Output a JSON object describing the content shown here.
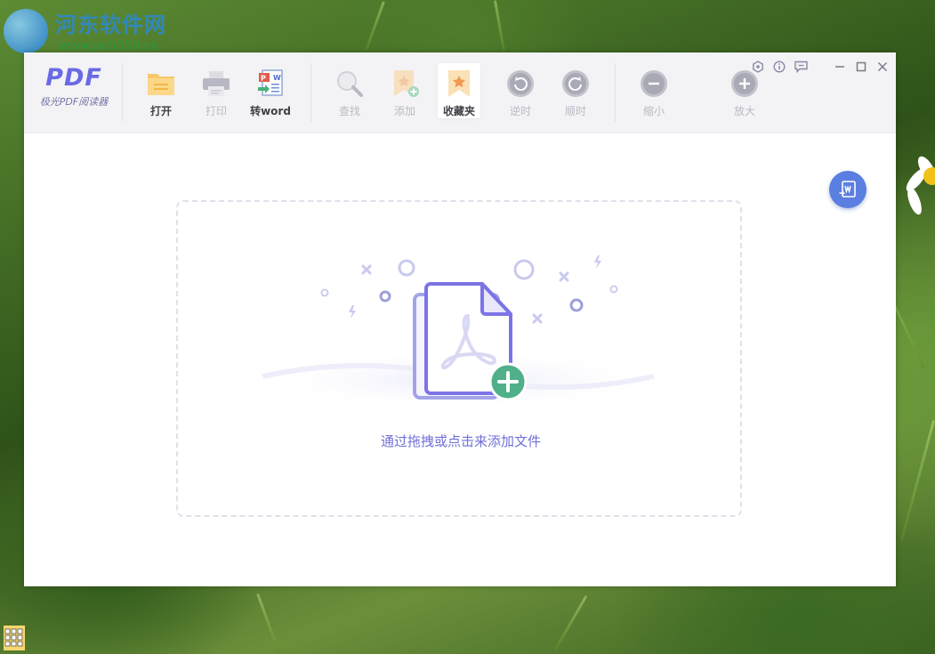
{
  "watermark": {
    "title": "河东软件网",
    "url": "www.pc0359.cn"
  },
  "app": {
    "logo_mark": "PDF",
    "logo_name": "极光PDF阅读器"
  },
  "toolbar": {
    "open": "打开",
    "print": "打印",
    "to_word": "转word",
    "find": "查找",
    "add": "添加",
    "favorites": "收藏夹",
    "rotate_ccw": "逆时",
    "rotate_cw": "顺时",
    "zoom_out": "缩小",
    "zoom_in": "放大"
  },
  "dropzone": {
    "hint": "通过拖拽或点击来添加文件"
  },
  "icons": {
    "open": "folder-icon",
    "print": "printer-icon",
    "to_word": "word-convert-icon",
    "find": "search-icon",
    "add": "bookmark-add-icon",
    "favorites": "bookmark-star-icon",
    "rotate_ccw": "rotate-ccw-icon",
    "rotate_cw": "rotate-cw-icon",
    "zoom_out": "minus-circle-icon",
    "zoom_in": "plus-circle-icon",
    "skin": "skin-icon",
    "info": "info-icon",
    "feedback": "feedback-icon",
    "minimize": "minimize-icon",
    "maximize": "maximize-icon",
    "close": "close-icon",
    "float": "word-to-pdf-icon"
  },
  "colors": {
    "accent": "#6a6ae6",
    "float_button": "#5b7fe0",
    "add_badge": "#4fb08a",
    "toolbar_bg": "#f3f3f5"
  }
}
